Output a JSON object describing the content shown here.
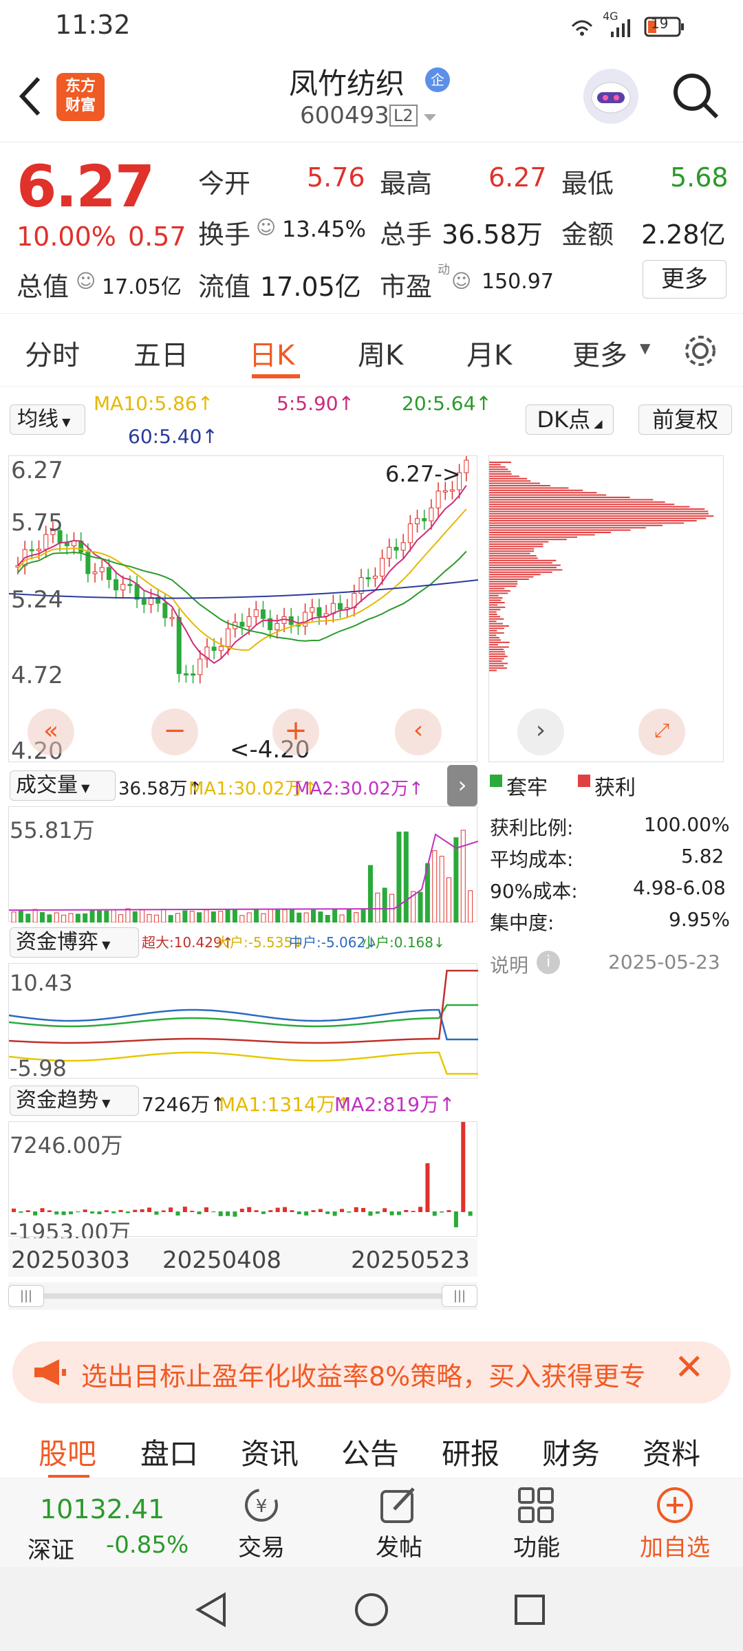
{
  "status": {
    "time": "11:32",
    "battery": "19",
    "signal": "4G"
  },
  "header": {
    "logo_line1": "东方",
    "logo_line2": "财富",
    "stock_name": "凤竹纺织",
    "code": "600493",
    "level": "L2",
    "badge": "企"
  },
  "quote": {
    "price": "6.27",
    "pct": "10.00%",
    "chg": "0.57",
    "open_label": "今开",
    "open": "5.76",
    "high_label": "最高",
    "high": "6.27",
    "low_label": "最低",
    "low": "5.68",
    "turnover_label": "换手",
    "turnover": "13.45%",
    "vol_label": "总手",
    "vol": "36.58万",
    "amount_label": "金额",
    "amount": "2.28亿",
    "mktcap_label": "总值",
    "mktcap": "17.05亿",
    "float_label": "流值",
    "float": "17.05亿",
    "pe_label": "市盈",
    "pe_sup": "动",
    "pe": "150.97",
    "more": "更多"
  },
  "tabs": {
    "items": [
      "分时",
      "五日",
      "日K",
      "周K",
      "月K",
      "更多"
    ],
    "active": "日K"
  },
  "kline": {
    "ma_label": "均线",
    "ma10": "MA10:5.86↑",
    "ma5": "5:5.90↑",
    "ma20": "20:5.64↑",
    "ma60": "60:5.40↑",
    "dk": "DK点",
    "fq": "前复权",
    "y_top": "6.27",
    "y2": "5.75",
    "y3": "5.24",
    "y4": "4.72",
    "y_bottom": "4.20",
    "high_mark": "6.27->",
    "low_mark": "<-4.20"
  },
  "volume": {
    "label": "成交量",
    "value": "36.58万↑",
    "ma1": "MA1:30.02万↑",
    "ma2": "MA2:30.02万↑",
    "ymax": "55.81万"
  },
  "fund_game": {
    "label": "资金博弈",
    "super": "超大:10.429↑",
    "large": "大户:-5.535↓",
    "mid": "中户:-5.062↓",
    "small": "小户:0.168↓",
    "ymax": "10.43",
    "ymin": "-5.98"
  },
  "fund_trend": {
    "label": "资金趋势",
    "value": "7246万↑",
    "ma1": "MA1:1314万↑",
    "ma2": "MA2:819万↑",
    "ymax": "7246.00万",
    "ymin": "-1953.00万"
  },
  "dates": [
    "20250303",
    "20250408",
    "20250523"
  ],
  "chips": {
    "legend_trap": "套牢",
    "legend_profit": "获利",
    "profit_ratio_label": "获利比例:",
    "profit_ratio": "100.00%",
    "avg_cost_label": "平均成本:",
    "avg_cost": "5.82",
    "cost90_label": "90%成本:",
    "cost90": "4.98-6.08",
    "conc_label": "集中度:",
    "conc": "9.95%",
    "note": "说明",
    "date": "2025-05-23"
  },
  "banner": {
    "text": "选出目标止盈年化收益率8%策略，买入获得更专"
  },
  "bottom_tabs": {
    "items": [
      "股吧",
      "盘口",
      "资讯",
      "公告",
      "研报",
      "财务",
      "资料"
    ],
    "active": "股吧"
  },
  "navbar": {
    "index_value": "10132.41",
    "index_name": "深证",
    "index_pct": "-0.85%",
    "trade": "交易",
    "post": "发帖",
    "func": "功能",
    "add": "加自选"
  },
  "colors": {
    "up": "#e0312b",
    "down": "#2a9a2a",
    "accent": "#f05a24"
  }
}
